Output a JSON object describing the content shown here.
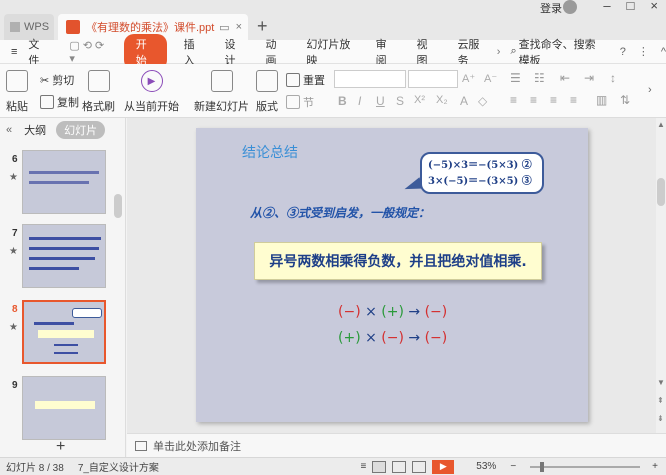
{
  "titlebar": {
    "wps_tab": "WPS",
    "doc_tab": "《有理数的乘法》课件.ppt",
    "add_tab": "+",
    "login": "登录"
  },
  "menu": {
    "file": "文件",
    "items": [
      "开始",
      "插入",
      "设计",
      "动画",
      "幻灯片放映",
      "审阅",
      "视图",
      "云服务"
    ],
    "search": "查找命令、搜索模板",
    "help": "?",
    "more": "⋮"
  },
  "ribbon": {
    "paste": "粘贴",
    "cut": "剪切",
    "copy": "复制",
    "format_painter": "格式刷",
    "from_current": "从当前开始",
    "new_slide": "新建幻灯片",
    "layout": "版式",
    "reset": "重置",
    "section": "节"
  },
  "leftpanel": {
    "outline_tab": "大纲",
    "slides_tab": "幻灯片",
    "thumbnails": [
      {
        "number": "6",
        "selected": false
      },
      {
        "number": "7",
        "selected": false
      },
      {
        "number": "8",
        "selected": true
      },
      {
        "number": "9",
        "selected": false
      }
    ],
    "add": "+"
  },
  "slide": {
    "title": "结论总结",
    "bubble_line1": "(−5)×3＝−(5×3) ②",
    "bubble_line2": "3×(−5)＝−(3×5) ③",
    "subtitle": "从②、③式受到启发，一般规定：",
    "rule_box": "异号两数相乘得负数，并且把绝对值相乘.",
    "sign_rule1": {
      "a": "(−)",
      "op": "×",
      "b": "(+)",
      "arrow": "→",
      "c": "(−)"
    },
    "sign_rule2": {
      "a": "(+)",
      "op": "×",
      "b": "(−)",
      "arrow": "→",
      "c": "(−)"
    }
  },
  "notes": {
    "placeholder": "单击此处添加备注"
  },
  "statusbar": {
    "slide_count": "幻灯片 8 / 38",
    "design": "7_自定义设计方案",
    "zoom": "53%",
    "zoom_minus": "−",
    "zoom_plus": "+",
    "zoom_level": 53
  },
  "colors": {
    "accent": "#e8572d",
    "slide_bg": "#c8cadb",
    "title_blue": "#3a8fd6",
    "text_navy": "#1e3f88",
    "rule_box_bg": "#fffdd0",
    "sign_red": "#d42f2f",
    "sign_green": "#2a9a3a"
  }
}
